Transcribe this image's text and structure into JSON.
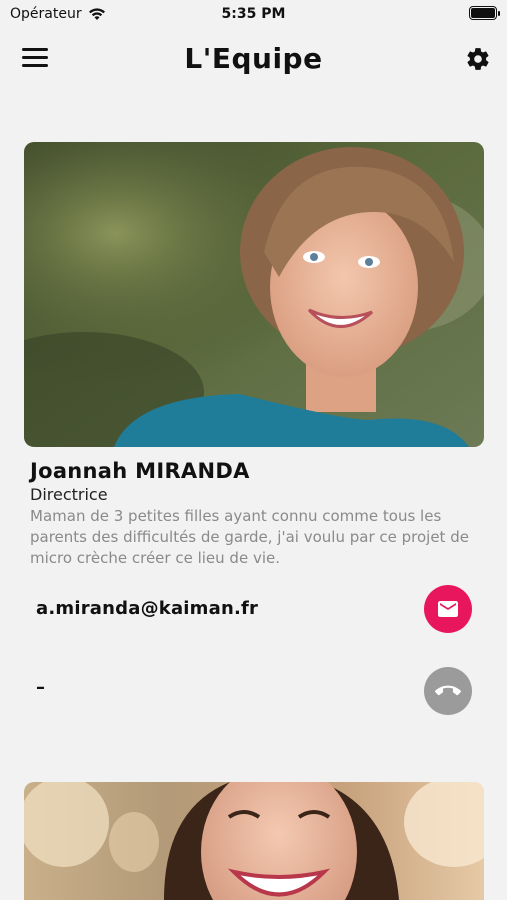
{
  "status_bar": {
    "carrier": "Opérateur",
    "time": "5:35 PM"
  },
  "header": {
    "title": "L'Equipe"
  },
  "icons": {
    "menu": "hamburger-menu-icon",
    "settings": "gear-icon",
    "email": "envelope-icon",
    "phone": "phone-icon"
  },
  "colors": {
    "email_button": "#e8175d",
    "phone_button_disabled": "#9b9b9b",
    "background": "#f2f2f2"
  },
  "team": [
    {
      "name": "Joannah MIRANDA",
      "role": "Directrice",
      "bio": "Maman de 3 petites filles ayant connu comme tous les parents des difficultés de garde, j'ai voulu par ce projet de micro crèche créer ce lieu de vie.",
      "email": "a.miranda@kaiman.fr",
      "phone": "–"
    }
  ]
}
